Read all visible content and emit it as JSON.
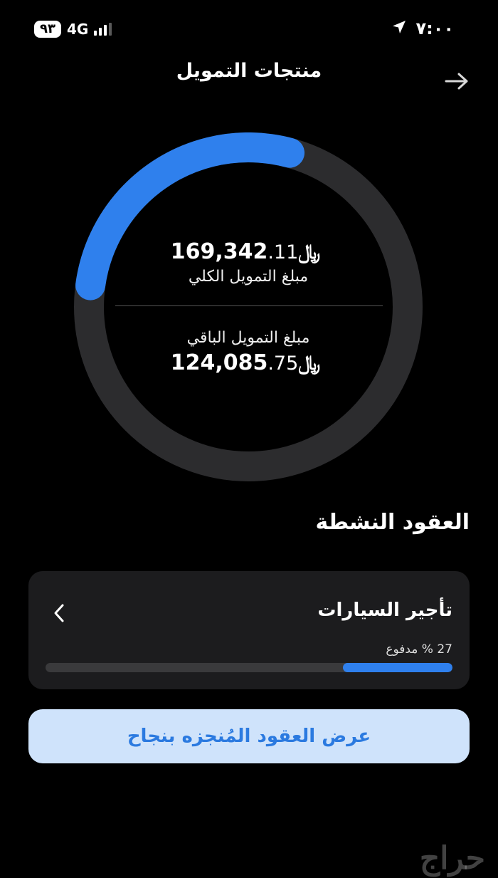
{
  "status_bar": {
    "battery": "٩٣",
    "network": "4G",
    "time": "٧:٠٠",
    "signal_bars": 3
  },
  "header": {
    "title": "منتجات التمويل",
    "back_icon": "arrow-right-icon"
  },
  "financing": {
    "total_label": "مبلغ التمويل الكلي",
    "total_int": "169,342",
    "total_dec": ".11",
    "remaining_label": "مبلغ التمويل الباقي",
    "remaining_int": "124,085",
    "remaining_dec": ".75",
    "currency_symbol": "﷼",
    "paid_fraction": 0.27,
    "colors": {
      "progress": "#2f80ed",
      "track": "#2c2c2e"
    }
  },
  "active_contracts": {
    "title": "العقود النشطة",
    "items": [
      {
        "name": "تأجير السيارات",
        "paid_text": "27 % مدفوع",
        "paid_percent": 27
      }
    ]
  },
  "completed_button_label": "عرض العقود المُنجزه بنجاح",
  "watermark": "حراج"
}
